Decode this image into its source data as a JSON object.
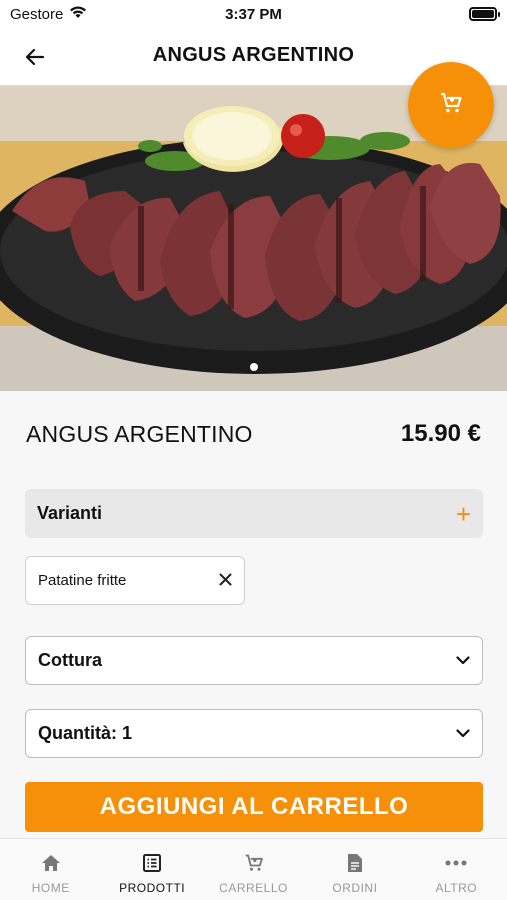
{
  "status_bar": {
    "carrier": "Gestore",
    "time": "3:37 PM"
  },
  "header": {
    "title": "ANGUS ARGENTINO"
  },
  "product": {
    "name": "ANGUS ARGENTINO",
    "price": "15.90 €"
  },
  "variants": {
    "label": "Varianti",
    "selected_chip": "Patatine fritte"
  },
  "cooking": {
    "label": "Cottura"
  },
  "quantity": {
    "label": "Quantità: 1"
  },
  "cta": {
    "label": "AGGIUNGI AL CARRELLO"
  },
  "tabs": [
    {
      "label": "HOME",
      "icon": "home-icon"
    },
    {
      "label": "PRODOTTI",
      "icon": "menu-list-icon"
    },
    {
      "label": "CARRELLO",
      "icon": "cart-icon"
    },
    {
      "label": "ORDINI",
      "icon": "document-icon"
    },
    {
      "label": "ALTRO",
      "icon": "more-dots-icon"
    }
  ],
  "colors": {
    "accent": "#f79009",
    "background": "#f7f7f7"
  }
}
